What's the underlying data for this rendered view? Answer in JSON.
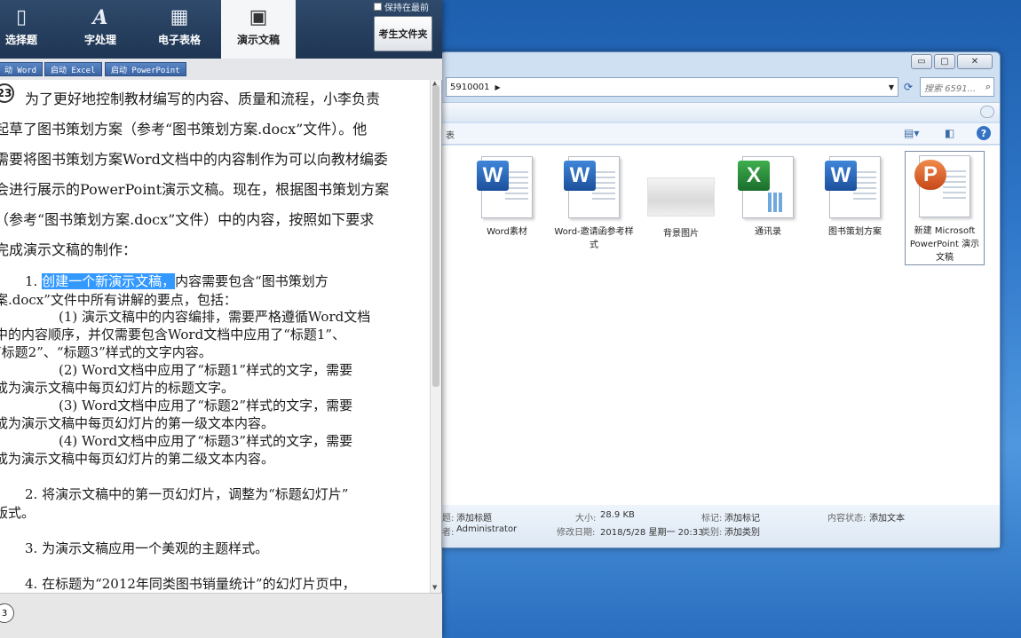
{
  "exam_nav": {
    "tabs": [
      {
        "label": "选择题",
        "icon": "document-icon"
      },
      {
        "label": "字处理",
        "icon": "letter-a-icon"
      },
      {
        "label": "电子表格",
        "icon": "spreadsheet-icon"
      },
      {
        "label": "演示文稿",
        "icon": "presentation-icon",
        "active": true
      }
    ],
    "keep_on_top": "保持在最前",
    "candidate_folder": "考生文件夹"
  },
  "launch_buttons": [
    "动 Word",
    "启动 Excel",
    "启动 PowerPoint"
  ],
  "question": {
    "number": "23",
    "intro_lines": [
      "为了更好地控制教材编写的内容、质量和流程，小李负责",
      "起草了图书策划方案（参考“图书策划方案.docx”文件）。他",
      "需要将图书策划方案Word文档中的内容制作为可以向教材编委",
      "会进行展示的PowerPoint演示文稿。现在，根据图书策划方案",
      "（参考“图书策划方案.docx”文件）中的内容，按照如下要求",
      "完成演示文稿的制作："
    ],
    "item1_num": "1.",
    "item1_highlight": "创建一个新演示文稿，",
    "item1_rest": "内容需要包含“图书策划方",
    "item1_cont": "案.docx”文件中所有讲解的要点，包括：",
    "sub_lines": [
      "(1) 演示文稿中的内容编排，需要严格遵循Word文档",
      "中的内容顺序，并仅需要包含Word文档中应用了“标题1”、",
      "“标题2”、“标题3”样式的文字内容。",
      "(2) Word文档中应用了“标题1”样式的文字，需要",
      "成为演示文稿中每页幻灯片的标题文字。",
      "(3) Word文档中应用了“标题2”样式的文字，需要",
      "成为演示文稿中每页幻灯片的第一级文本内容。",
      "(4) Word文档中应用了“标题3”样式的文字，需要",
      "成为演示文稿中每页幻灯片的第二级文本内容。"
    ],
    "item2": "2.  将演示文稿中的第一页幻灯片，调整为“标题幻灯片”",
    "item2_cont": "版式。",
    "item3": "3.  为演示文稿应用一个美观的主题样式。",
    "item4": "4.  在标题为“2012年同类图书销量统计”的幻灯片页中，"
  },
  "page_indicator": "3",
  "explorer": {
    "controls": [
      "▭",
      "▢",
      "✕"
    ],
    "address": "5910001",
    "search_placeholder": "搜索 6591...",
    "column_hint": "表",
    "files": [
      {
        "name": "Word素材",
        "type": "word"
      },
      {
        "name": "Word-邀请函参考样式",
        "type": "word"
      },
      {
        "name": "背景图片",
        "type": "image"
      },
      {
        "name": "通讯录",
        "type": "excel"
      },
      {
        "name": "图书策划方案",
        "type": "word"
      },
      {
        "name": "新建 Microsoft PowerPoint 演示文稿",
        "type": "ppt",
        "selected": true
      }
    ],
    "details": {
      "title_label": "题:",
      "title_value": "添加标题",
      "author_label": "者:",
      "author_value": "Administrator",
      "size_label": "大小:",
      "size_value": "28.9 KB",
      "modified_label": "修改日期:",
      "modified_value": "2018/5/28 星期一 20:33",
      "tags_label": "标记:",
      "tags_value": "添加标记",
      "category_label": "类别:",
      "category_value": "添加类别",
      "status_label": "内容状态:",
      "status_value": "添加文本"
    }
  }
}
